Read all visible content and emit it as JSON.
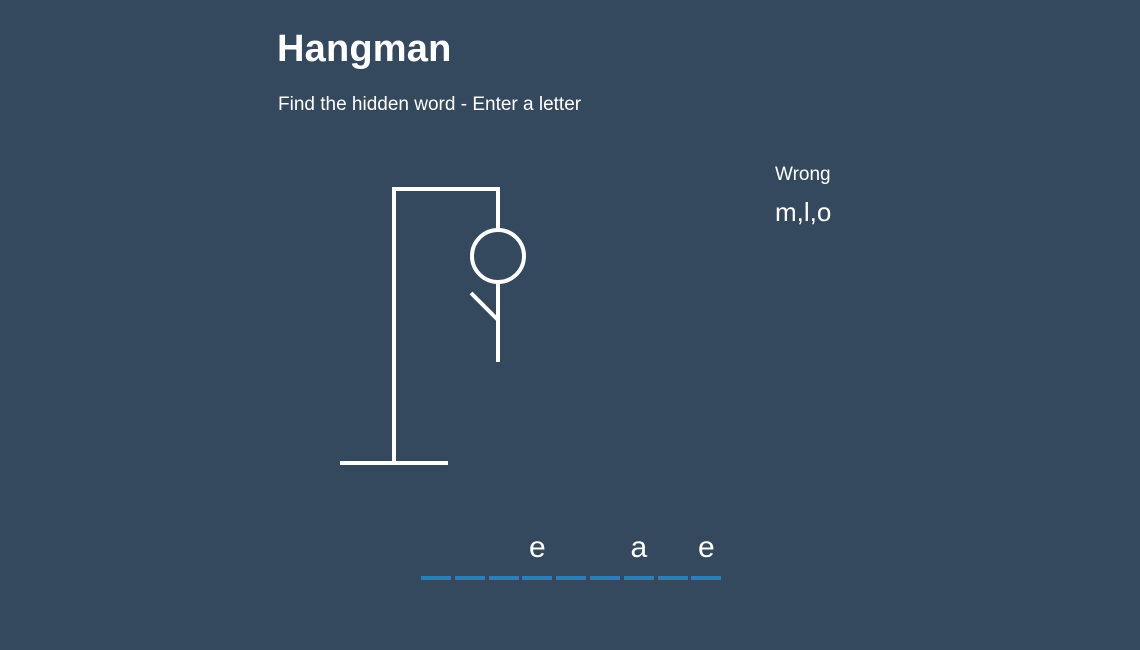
{
  "title": "Hangman",
  "subtitle": "Find the hidden word - Enter a letter",
  "wrong": {
    "label": "Wrong",
    "letters": "m,l,o"
  },
  "word": {
    "letters": [
      "",
      "",
      "",
      "e",
      "",
      "",
      "a",
      "",
      "e"
    ]
  },
  "hangman_parts_visible": [
    "gallows",
    "head",
    "body",
    "left-arm"
  ],
  "colors": {
    "background": "#34495e",
    "text": "#ffffff",
    "underline": "#2980b9"
  }
}
